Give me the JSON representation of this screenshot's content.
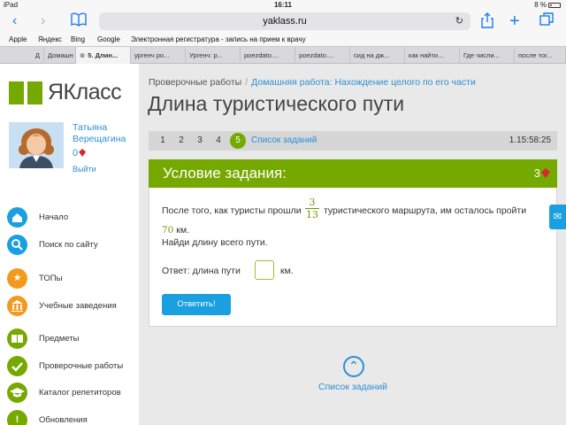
{
  "status": {
    "device": "iPad",
    "time": "16:11",
    "battery": "8 %"
  },
  "browser": {
    "url": "yaklass.ru",
    "bookmarks": [
      "Apple",
      "Яндекс",
      "Bing",
      "Google",
      "Электронная регистратура - запись на прием к врачу"
    ],
    "tabs": [
      "Д",
      "Домашн",
      "5. Длин...",
      "ургенч ро...",
      "Ургенч: р...",
      "poezdato....",
      "poezdato....",
      "сид на дж...",
      "как найти...",
      "Где числи...",
      "после тог..."
    ]
  },
  "sidebar": {
    "logo": "ЯКласс",
    "user": {
      "name": "Татьяна Верещагина",
      "score": "0",
      "logout": "Выйти"
    },
    "nav": [
      {
        "label": "Начало",
        "icon": "home-icon",
        "color": "#1a9fe0"
      },
      {
        "label": "Поиск по сайту",
        "icon": "search-icon",
        "color": "#1a9fe0"
      },
      {
        "label": "ТОПы",
        "icon": "star-icon",
        "color": "#f39a1e"
      },
      {
        "label": "Учебные заведения",
        "icon": "school-icon",
        "color": "#f39a1e"
      },
      {
        "label": "Предметы",
        "icon": "books-icon",
        "color": "#76a900"
      },
      {
        "label": "Проверочные работы",
        "icon": "check-icon",
        "color": "#76a900"
      },
      {
        "label": "Каталог репетиторов",
        "icon": "graduation-cap-icon",
        "color": "#76a900"
      },
      {
        "label": "Обновления",
        "icon": "exclamation-icon",
        "color": "#76a900"
      }
    ]
  },
  "main": {
    "breadcrumb": {
      "root": "Проверочные работы",
      "current": "Домашняя работа: Нахождение целого по его части"
    },
    "title": "Длина туристического пути",
    "questions": [
      "1",
      "2",
      "3",
      "4",
      "5"
    ],
    "active_question": "5",
    "task_list": "Список заданий",
    "timer": "1.15:58:25",
    "card": {
      "header": "Условие задания:",
      "points": "3",
      "text_before": "После того, как туристы прошли",
      "fraction_num": "3",
      "fraction_den": "13",
      "text_after": "туристического маршрута, им осталось пройти",
      "distance": "70",
      "unit": "км.",
      "question": "Найди длину всего пути.",
      "answer_label": "Ответ: длина пути",
      "answer_unit": "км.",
      "submit": "Ответить!"
    },
    "bottom_link": "Список заданий"
  }
}
